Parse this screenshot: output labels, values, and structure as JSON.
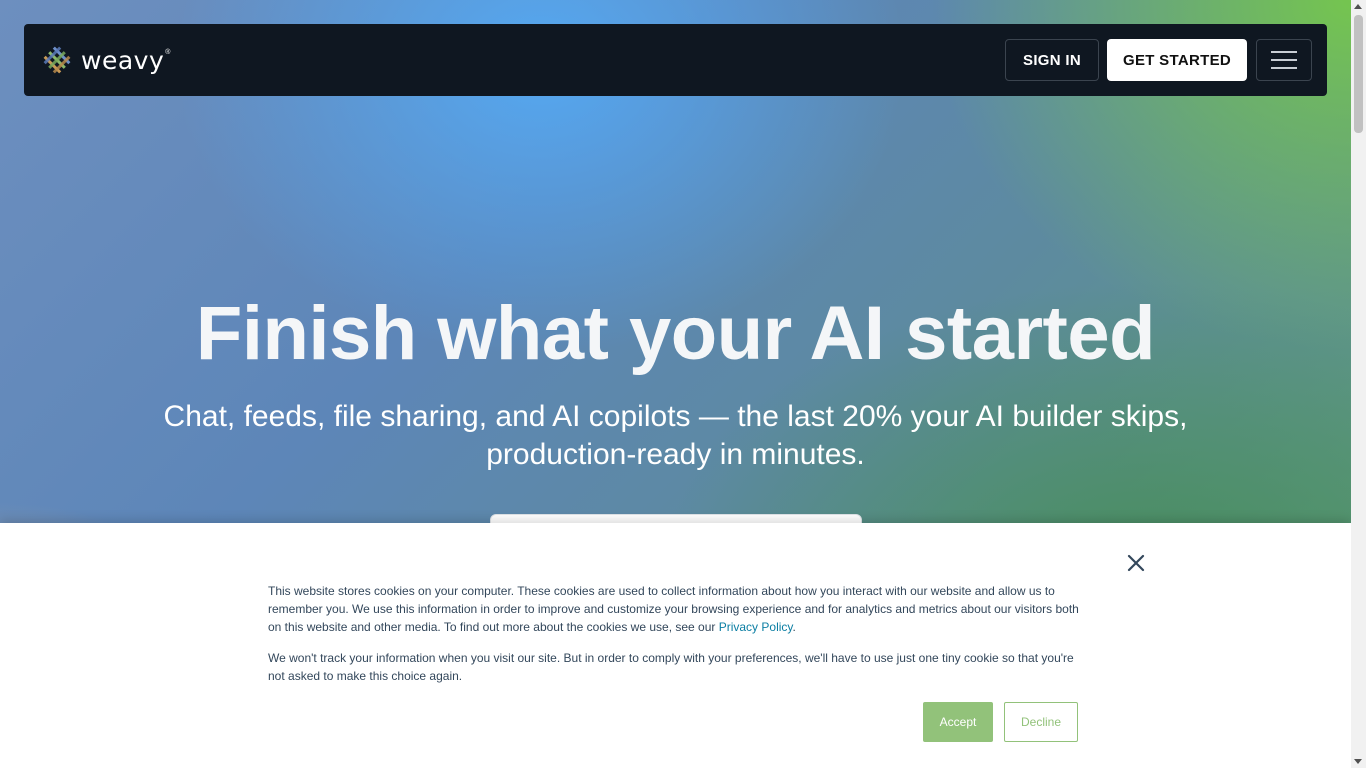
{
  "nav": {
    "brand": "weavy",
    "brand_mark": "®",
    "sign_in_label": "SIGN IN",
    "get_started_label": "GET STARTED",
    "menu_icon": "hamburger-menu-icon"
  },
  "hero": {
    "headline": "Finish what your AI started",
    "subhead": "Chat, feeds, file sharing, and AI copilots — the last 20% your AI builder skips, production-ready in minutes."
  },
  "cookie_banner": {
    "para1_before_link": "This website stores cookies on your computer. These cookies are used to collect information about how you interact with our website and allow us to remember you. We use this information in order to improve and customize your browsing experience and for analytics and metrics about our visitors both on this website and other media. To find out more about the cookies we use, see our ",
    "privacy_link": "Privacy Policy",
    "para1_after_link": ".",
    "para2": "We won't track your information when you visit our site. But in order to comply with your preferences, we'll have to use just one tiny cookie so that you're not asked to make this choice again.",
    "accept_label": "Accept",
    "decline_label": "Decline",
    "close_icon": "close-icon"
  },
  "colors": {
    "nav_bg": "#0f1721",
    "accent_green": "#92c27a",
    "link": "#0b7ea3",
    "cookie_text": "#33475b"
  }
}
